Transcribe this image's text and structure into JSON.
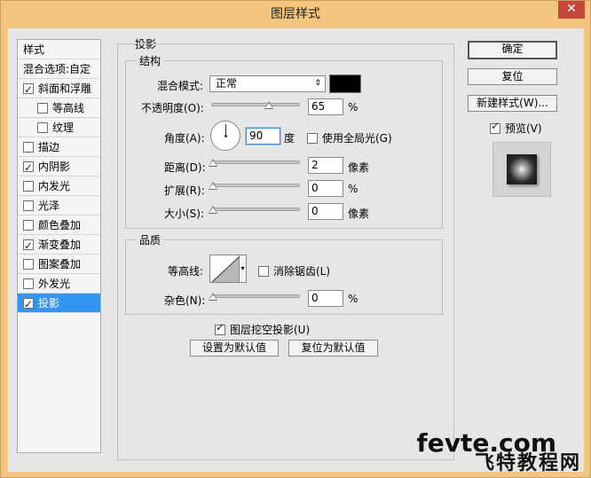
{
  "window": {
    "title": "图层样式",
    "close_glyph": "✕"
  },
  "styles_panel": {
    "header": "样式",
    "blend_options": "混合选项:自定",
    "items": [
      {
        "label": "斜面和浮雕",
        "checked": true,
        "indent": false
      },
      {
        "label": "等高线",
        "checked": false,
        "indent": true
      },
      {
        "label": "纹理",
        "checked": false,
        "indent": true
      },
      {
        "label": "描边",
        "checked": false,
        "indent": false
      },
      {
        "label": "内阴影",
        "checked": true,
        "indent": false
      },
      {
        "label": "内发光",
        "checked": false,
        "indent": false
      },
      {
        "label": "光泽",
        "checked": false,
        "indent": false
      },
      {
        "label": "颜色叠加",
        "checked": false,
        "indent": false
      },
      {
        "label": "渐变叠加",
        "checked": true,
        "indent": false
      },
      {
        "label": "图案叠加",
        "checked": false,
        "indent": false
      },
      {
        "label": "外发光",
        "checked": false,
        "indent": false
      },
      {
        "label": "投影",
        "checked": true,
        "indent": false,
        "selected": true
      }
    ]
  },
  "drop_shadow": {
    "section_title": "投影",
    "structure": {
      "title": "结构",
      "blend_mode_label": "混合模式:",
      "blend_mode_value": "正常",
      "blend_arrow": "⇕",
      "shadow_color": "#000000",
      "opacity_label": "不透明度(O):",
      "opacity_value": "65",
      "opacity_percent": 65,
      "opacity_unit": "%",
      "angle_label": "角度(A):",
      "angle_value": "90",
      "angle_unit": "度",
      "global_light_label": "使用全局光(G)",
      "global_light_checked": false,
      "distance_label": "距离(D):",
      "distance_value": "2",
      "distance_unit": "像素",
      "spread_label": "扩展(R):",
      "spread_value": "0",
      "spread_unit": "%",
      "size_label": "大小(S):",
      "size_value": "0",
      "size_unit": "像素"
    },
    "quality": {
      "title": "品质",
      "contour_label": "等高线:",
      "anti_alias_label": "消除锯齿(L)",
      "anti_alias_checked": false,
      "noise_label": "杂色(N):",
      "noise_value": "0",
      "noise_unit": "%"
    },
    "knockout_label": "图层挖空投影(U)",
    "knockout_checked": true,
    "make_default": "设置为默认值",
    "reset_default": "复位为默认值"
  },
  "actions": {
    "ok": "确定",
    "reset": "复位",
    "new_style": "新建样式(W)...",
    "preview_label": "预览(V)",
    "preview_checked": true
  },
  "watermark": {
    "en": "fevte.com",
    "cn": "飞特教程网"
  }
}
